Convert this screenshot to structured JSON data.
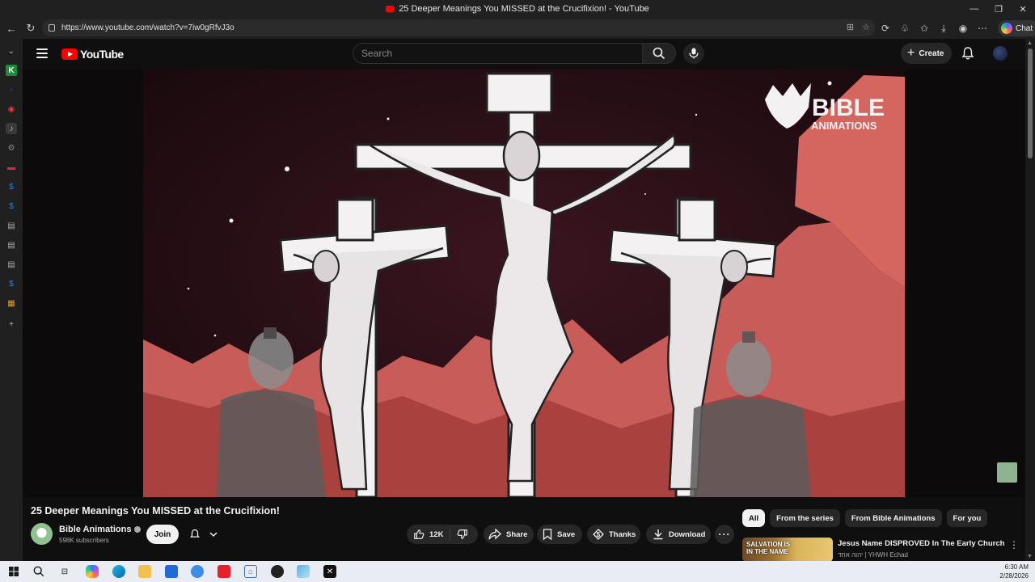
{
  "browser": {
    "window_title": "25 Deeper Meanings You MISSED at the Crucifixion! - YouTube",
    "url": "https://www.youtube.com/watch?v=7iw0gRfvJ3o",
    "chat_label": "Chat"
  },
  "header": {
    "logo_text": "YouTube",
    "search_placeholder": "Search",
    "create_label": "Create"
  },
  "video": {
    "watermark_line1": "BIBLE",
    "watermark_line2": "ANIMATIONS"
  },
  "meta": {
    "title": "25 Deeper Meanings You MISSED at the Crucifixion!",
    "channel_name": "Bible Animations",
    "subscribers": "598K subscribers",
    "join_label": "Join",
    "like_count": "12K",
    "share_label": "Share",
    "save_label": "Save",
    "thanks_label": "Thanks",
    "download_label": "Download",
    "more_label": "···"
  },
  "chips": [
    "All",
    "From the series",
    "From Bible Animations",
    "For you"
  ],
  "recommendation": {
    "thumb_text": "SALVATION IS IN THE NAME",
    "title": "Jesus Name DISPROVED In The Early Church",
    "channel": "יהוה אחד | YHWH Echad"
  },
  "tray": {
    "time": "6:30 AM",
    "date": "2/28/2026"
  },
  "colors": {
    "yt_red": "#ff0000",
    "page_bg": "#0f0f0f",
    "pill_bg": "#272727"
  }
}
